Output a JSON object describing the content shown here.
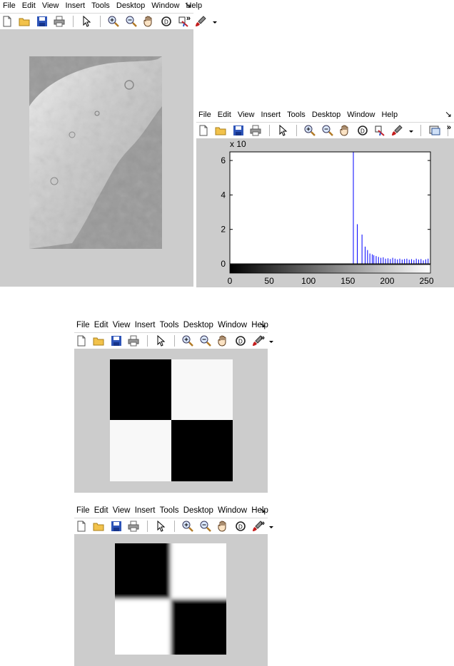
{
  "menu": [
    "File",
    "Edit",
    "View",
    "Insert",
    "Tools",
    "Desktop",
    "Window",
    "Help"
  ],
  "dock_icon": "dock-arrow-icon",
  "toolbar_more": "»",
  "histogram": {
    "chart_data": {
      "type": "bar",
      "xlabel": "",
      "ylabel": "",
      "y_multiplier_label": "x 10",
      "xlim": [
        0,
        255
      ],
      "ylim": [
        0,
        6.5
      ],
      "xticks": [
        "0",
        "50",
        "100",
        "150",
        "200",
        "250"
      ],
      "xtick_values": [
        0,
        50,
        100,
        150,
        200,
        250
      ],
      "yticks": [
        "0",
        "2",
        "4",
        "6"
      ],
      "ytick_values": [
        0,
        2,
        4,
        6
      ],
      "bar_color": "#0000ff",
      "bins": [
        157,
        162,
        168,
        172,
        175,
        178,
        181,
        183,
        186,
        189,
        192,
        195,
        198,
        201,
        204,
        207,
        210,
        213,
        216,
        219,
        222,
        225,
        228,
        231,
        234,
        237,
        240,
        243,
        246,
        249,
        252,
        255
      ],
      "values": [
        6.5,
        2.3,
        1.7,
        1.0,
        0.8,
        0.6,
        0.55,
        0.5,
        0.45,
        0.4,
        0.35,
        0.38,
        0.3,
        0.32,
        0.28,
        0.35,
        0.3,
        0.26,
        0.3,
        0.25,
        0.28,
        0.3,
        0.24,
        0.27,
        0.22,
        0.3,
        0.25,
        0.28,
        0.2,
        0.26,
        0.3,
        0.22
      ]
    }
  },
  "colors": {
    "figure_bg": "#cccccc",
    "bar": "#0000ff"
  }
}
